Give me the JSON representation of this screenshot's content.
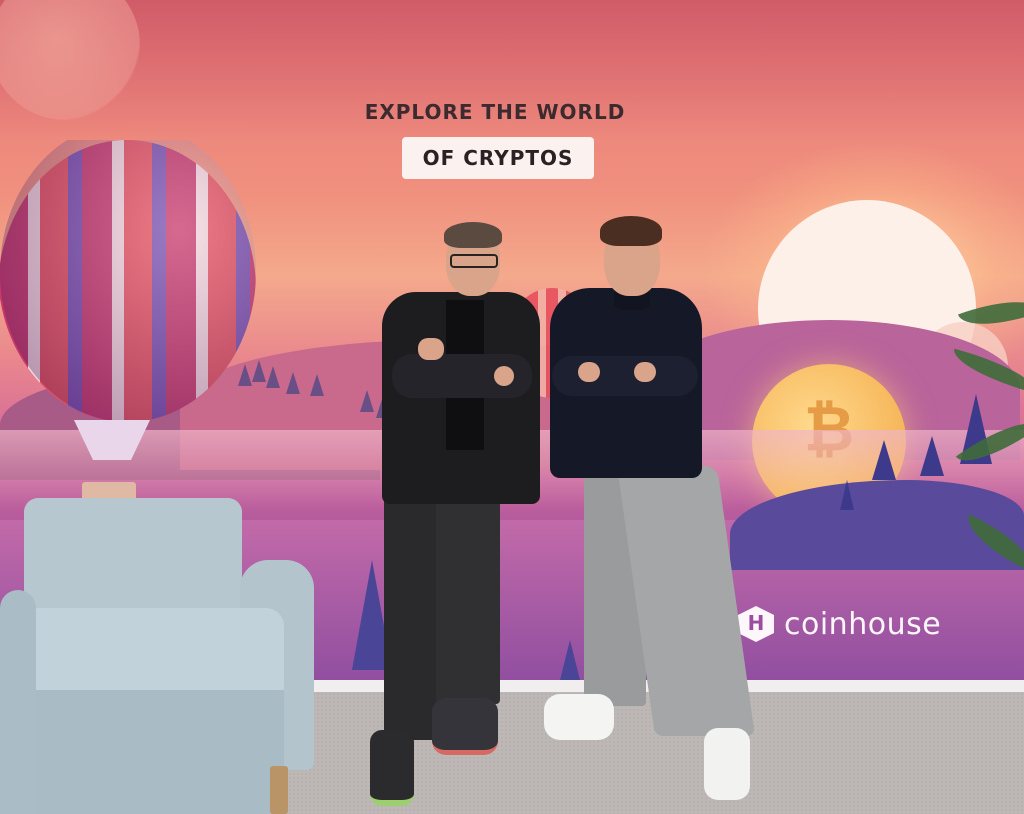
{
  "mural": {
    "headline_line1": "EXPLORE THE WORLD",
    "headline_line2": "OF CRYPTOS",
    "brand_name": "coinhouse",
    "coin_symbol": "₿"
  },
  "colors": {
    "mural_top": "#e7777a",
    "mural_bottom": "#9a4f9c",
    "headline_text": "#3b2a2e",
    "headline_box": "#fbf2ef",
    "brand": "#fdf7fb",
    "armchair": "#b6c7d0",
    "floor": "#bdb8b6"
  }
}
